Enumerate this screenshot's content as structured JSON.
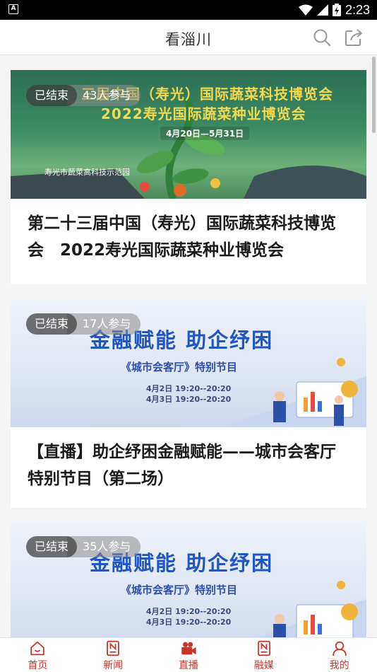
{
  "status_bar": {
    "time": "2:23",
    "icons": [
      "app-notification-icon",
      "wifi-icon",
      "signal-icon",
      "battery-icon"
    ]
  },
  "header": {
    "title": "看淄川",
    "icons": [
      "search-icon",
      "share-icon"
    ]
  },
  "cards": [
    {
      "status": "已结束",
      "participants": "43人参与",
      "title": "第二十三届中国（寿光）国际蔬菜科技博览会　2022寿光国际蔬菜种业博览会",
      "banner": {
        "line1": "三届中国（寿光）国际蔬菜科技博览会",
        "line2": "2022寿光国际蔬菜种业博览会",
        "date": "4月20日—5月31日",
        "sign": "寿光市蔬菜高科技示范园"
      }
    },
    {
      "status": "已结束",
      "participants": "17人参与",
      "title": "【直播】助企纾困金融赋能——城市会客厅特别节目（第二场）",
      "banner": {
        "headline": "金融赋能 助企纾困",
        "subtitle": "《城市会客厅》特别节目",
        "time1": "4月2日 19:20--20:20",
        "time2": "4月3日 19:20--20:20"
      }
    },
    {
      "status": "已结束",
      "participants": "35人参与",
      "title": "",
      "banner": {
        "headline": "金融赋能 助企纾困",
        "subtitle": "《城市会客厅》特别节目",
        "time1": "4月2日 19:20--20:20",
        "time2": "4月3日 19:20--20:20"
      }
    }
  ],
  "bottom_nav": [
    {
      "label": "首页",
      "icon": "home-icon"
    },
    {
      "label": "新闻",
      "icon": "news-icon"
    },
    {
      "label": "直播",
      "icon": "camera-icon"
    },
    {
      "label": "融媒",
      "icon": "media-icon"
    },
    {
      "label": "我的",
      "icon": "user-icon"
    }
  ],
  "colors": {
    "accent": "#c9342a",
    "status_bar": "#000000",
    "finance_blue": "#1f56c4"
  }
}
